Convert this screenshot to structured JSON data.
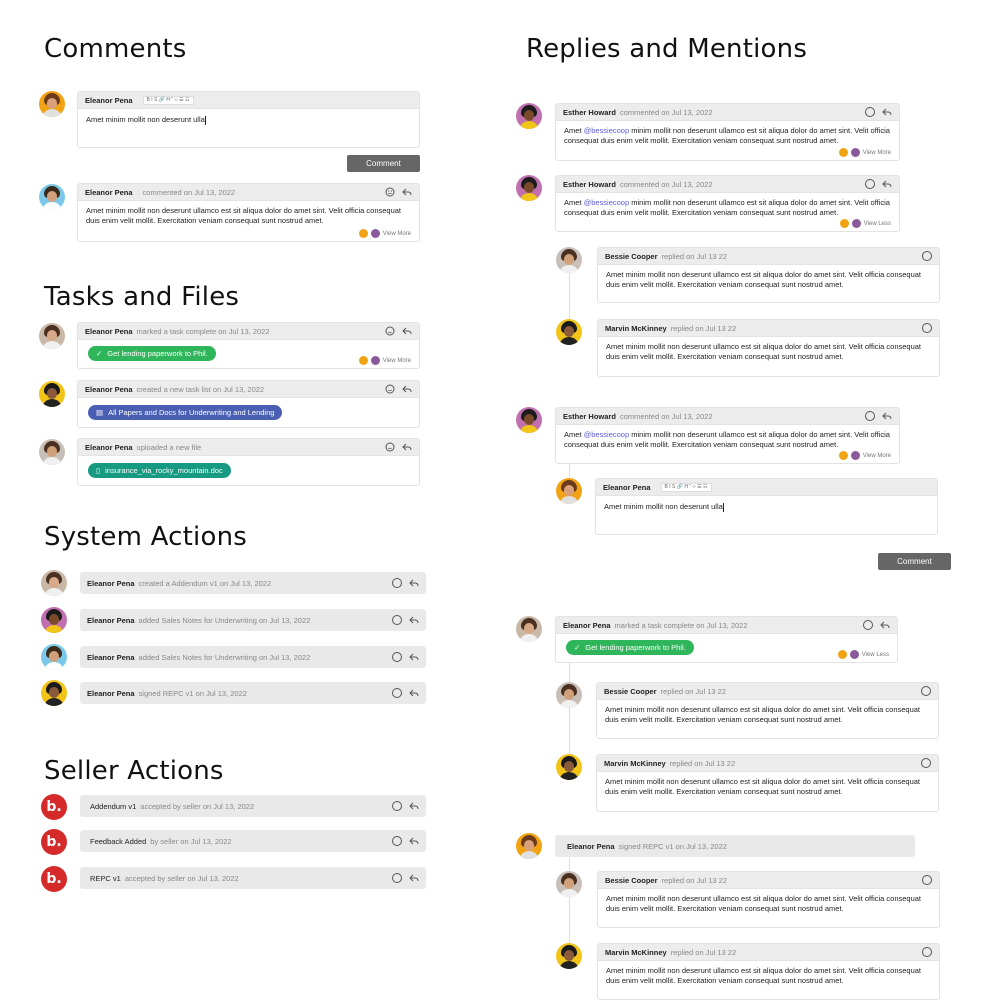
{
  "sections": {
    "comments": "Comments",
    "replies": "Replies and Mentions",
    "tasks": "Tasks and Files",
    "system": "System Actions",
    "seller": "Seller Actions"
  },
  "names": {
    "eleanor": "Eleanor Pena",
    "esther": "Esther Howard",
    "bessie": "Bessie Cooper",
    "marvin": "Marvin McKinney"
  },
  "meta": {
    "commented": "commented on Jul 13, 2022",
    "replied": "replied on Jul 13 22",
    "task_complete": "marked a task complete on Jul 13, 2022",
    "task_list": "created a new task list on Jul 13, 2022",
    "uploaded": "uploaded a new file",
    "signed": "signed REPC v1 on Jul 13, 2022"
  },
  "editor": {
    "text": "Amet minim mollit non deserunt ulla",
    "toolbar": "B  I  S  🔗   H  ”  ‹›  ☰  ☷",
    "button": "Comment"
  },
  "text": {
    "comment_body": "Amet minim mollit non deserunt ullamco est sit aliqua dolor do amet sint. Velit officia consequat duis enim velit mollit. Exercitation veniam consequat sunt nostrud amet.",
    "mention_pre": "Amet ",
    "mention": "@bessiecoop",
    "mention_post": " minim mollit non deserunt ullamco est sit aliqua dolor do amet sint. Velit officia consequat duis enim velit mollit. Exercitation veniam consequat sunt nostrud amet.",
    "view_more": "View More",
    "view_less": "View Less"
  },
  "tasks": {
    "complete": "Get lending paperwork to Phil.",
    "list": "All Papers and Docs for Underwriting and Lending",
    "file": "insurance_via_rocky_mountain.doc"
  },
  "system": [
    {
      "name": "Eleanor Pena",
      "meta": "created a Addendum v1 on Jul 13, 2022"
    },
    {
      "name": "Eleanor Pena",
      "meta": "added Sales Notes for Underwriting on Jul 13, 2022"
    },
    {
      "name": "Eleanor Pena",
      "meta": "added Sales Notes for Underwriting on Jul 13, 2022"
    },
    {
      "name": "Eleanor Pena",
      "meta": "signed REPC v1 on Jul 13, 2022"
    }
  ],
  "seller": [
    {
      "name": "Addendum v1",
      "meta": "accepted by seller on Jul 13, 2022"
    },
    {
      "name": "Feedback Added",
      "meta": "by seller on Jul 13, 2022"
    },
    {
      "name": "REPC v1",
      "meta": "accepted by seller on Jul 13, 2022"
    }
  ],
  "seller_logo": "b.",
  "colors": {
    "green": "#2fb55a",
    "blue": "#4a5fb3",
    "teal": "#169a82",
    "button": "#666666",
    "mention": "#5b5bd6",
    "seller_red": "#d42a2a"
  }
}
